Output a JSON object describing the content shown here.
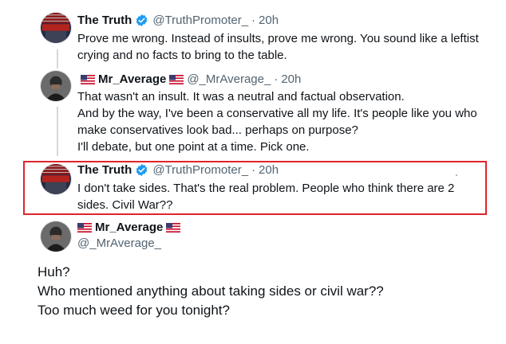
{
  "colors": {
    "highlight": "#e0242b",
    "verified": "#1d9bf0",
    "muted": "#536471"
  },
  "tweets": [
    {
      "name": "The Truth",
      "handle": "@TruthPromoter_",
      "time": "20h",
      "verified": true,
      "text": [
        "Prove me wrong. Instead of insults, prove me wrong. You sound like a leftist",
        "crying and no facts to bring to the table."
      ]
    },
    {
      "name": "Mr_Average",
      "handle": "@_MrAverage_",
      "time": "20h",
      "flags": [
        "us-flag-icon",
        "us-flag-icon"
      ],
      "text": [
        "That wasn't an insult. It was a neutral and factual observation.",
        "And by the way, I've been a conservative all my life. It's people like you who",
        "make conservatives look bad... perhaps on purpose?",
        "I'll debate, but one point at a time. Pick one."
      ]
    },
    {
      "name": "The Truth",
      "handle": "@TruthPromoter_",
      "time": "20h",
      "verified": true,
      "text": [
        "I don't take sides. That's the real problem. People who think there are 2",
        "sides. Civil War??"
      ]
    }
  ],
  "reply": {
    "name": "Mr_Average",
    "handle": "@_MrAverage_",
    "text": [
      "Huh?",
      "Who mentioned anything about taking sides or civil war??",
      "Too much weed for you tonight?"
    ]
  },
  "dot": "·"
}
